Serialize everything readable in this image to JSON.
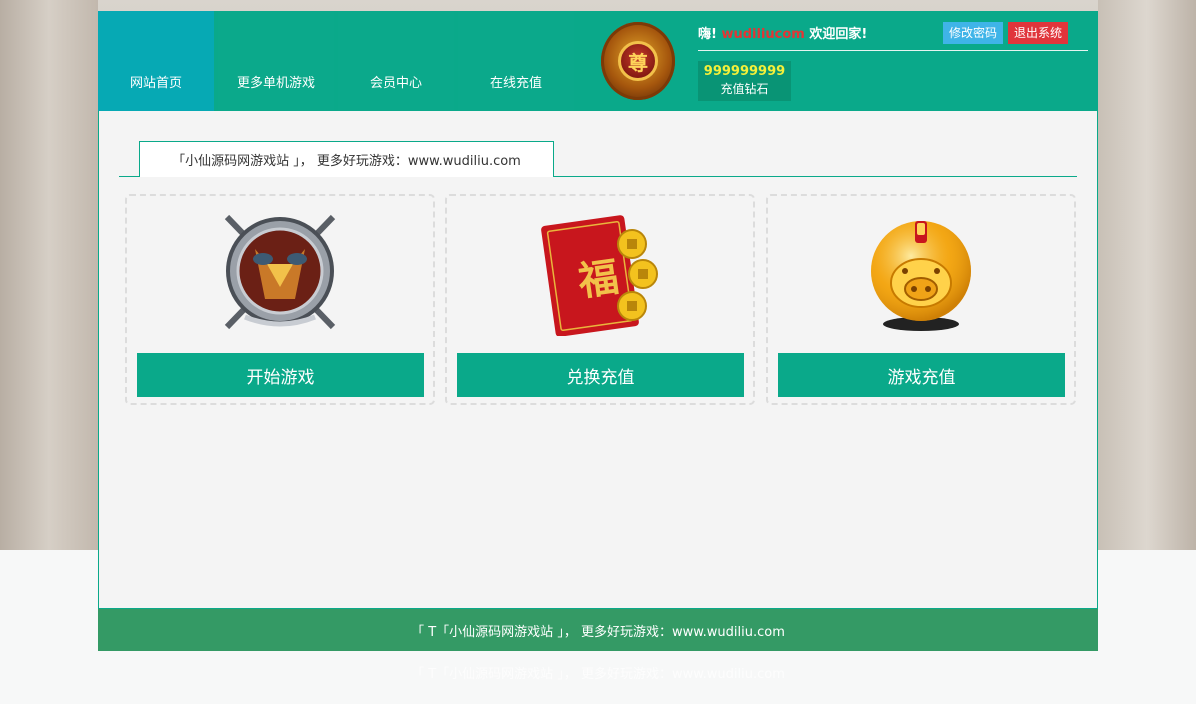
{
  "header": {
    "nav": [
      {
        "label": "网站首页",
        "active": true
      },
      {
        "label": "更多单机游戏",
        "active": false
      },
      {
        "label": "会员中心",
        "active": false
      },
      {
        "label": "在线充值",
        "active": false
      }
    ],
    "vip_badge": "尊",
    "greeting_prefix": "嗨!",
    "username": "wudiliucom",
    "greeting_suffix": "欢迎回家!",
    "change_password": "修改密码",
    "logout": "退出系统",
    "diamond_value": "999999999",
    "diamond_label": "充值钻石"
  },
  "main": {
    "tab_title": "「小仙源码网游戏站 」， 更多好玩游戏：www.wudiliu.com",
    "cards": [
      {
        "icon": "crossed-swords-emblem-icon",
        "button": "开始游戏"
      },
      {
        "icon": "red-envelope-fu-icon",
        "button": "兑换充值",
        "fu": "福"
      },
      {
        "icon": "golden-piggy-bank-icon",
        "button": "游戏充值"
      }
    ]
  },
  "footer": {
    "text": "「 T「小仙源码网游戏站 」， 更多好玩游戏：www.wudiliu.com",
    "ghost_text": "「 T「小仙源码网游戏站 」， 更多好玩游戏：www.wudiliu.com"
  },
  "colors": {
    "primary": "#0aa98a",
    "active_nav": "#06a9b4",
    "footer": "#349a65",
    "username": "#e53434",
    "diamond": "#f3f03a"
  }
}
